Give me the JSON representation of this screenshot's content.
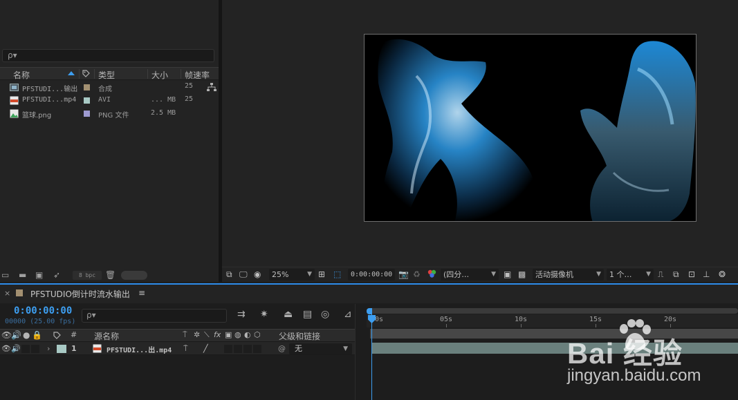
{
  "project": {
    "search_placeholder": "",
    "search_icon": "ρ▾",
    "columns": {
      "name": "名称",
      "type": "类型",
      "size": "大小",
      "fps": "帧速率"
    },
    "items": [
      {
        "name": "PFSTUDI...输出",
        "type": "合成",
        "size": "",
        "fps": "25",
        "icon": "composition-icon",
        "label_color": "#a39071"
      },
      {
        "name": "PFSTUDI...mp4",
        "type": "AVI",
        "size": "... MB",
        "fps": "25",
        "icon": "video-file-icon",
        "label_color": "#a8c9c4"
      },
      {
        "name": "篮球.png",
        "type": "PNG 文件",
        "size": "2.5 MB",
        "fps": "",
        "icon": "image-file-icon",
        "label_color": "#9d9ad0"
      }
    ],
    "bit_depth": "8 bpc"
  },
  "viewer": {
    "zoom": "25%",
    "timecode": "0:00:00:00",
    "resolution": "(四分…",
    "camera": "活动摄像机",
    "views": "1 个…"
  },
  "timeline": {
    "close": "×",
    "comp_title": "PFSTUDIO倒计时流水输出",
    "menu": "≡",
    "current_time": "0:00:00:00",
    "frame_info": "00000 (25.00 fps)",
    "ruler": [
      "00s",
      "05s",
      "10s",
      "15s",
      "20s"
    ],
    "headers": {
      "hash": "#",
      "source_name": "源名称",
      "parent": "父级和链接"
    },
    "layers": [
      {
        "index": "1",
        "name": "PFSTUDI...出.mp4",
        "parent": "无",
        "label_color": "#a8c9c4"
      }
    ]
  },
  "watermark": {
    "brand": "Bai  经验",
    "url": "jingyan.baidu.com"
  }
}
